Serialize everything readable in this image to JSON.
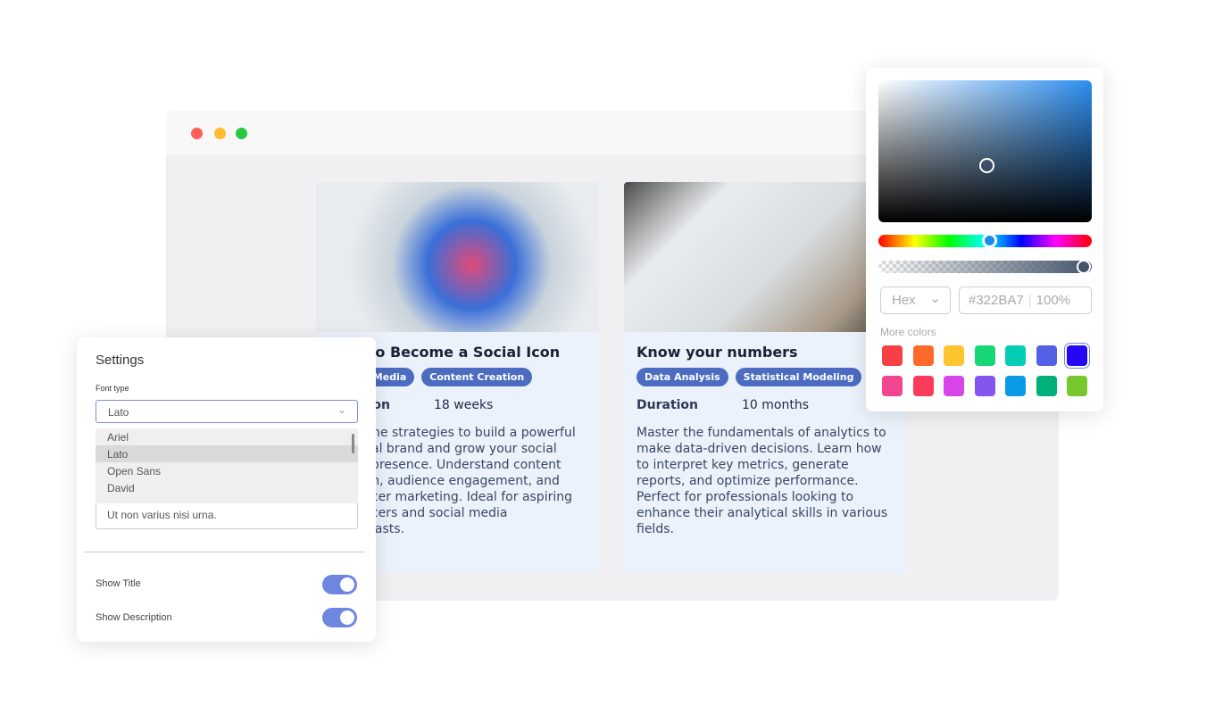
{
  "window": {
    "controls": [
      "#fe5f57",
      "#febc2e",
      "#28c840"
    ]
  },
  "cards": [
    {
      "title": "How to Become a Social Icon",
      "tags": [
        "Social Media",
        "Content Creation"
      ],
      "duration_label": "Duration",
      "duration": "18 weeks",
      "description": "Learn the strategies to build a powerful personal brand and grow your social media presence. Understand content creation, audience engagement, and influencer marketing. Ideal for aspiring influencers and social media enthusiasts."
    },
    {
      "title": "Know your numbers",
      "tags": [
        "Data Analysis",
        "Statistical Modeling"
      ],
      "duration_label": "Duration",
      "duration": "10 months",
      "description": "Master the fundamentals of analytics to make data-driven decisions. Learn how to interpret key metrics, generate reports, and optimize performance. Perfect for professionals looking to enhance their analytical skills in various fields."
    }
  ],
  "settings": {
    "title": "Settings",
    "font_label": "Font type",
    "font_value": "Lato",
    "options": [
      "Ariel",
      "Lato",
      "Open Sans",
      "David"
    ],
    "textarea": "Ut non varius nisi urna.",
    "show_title": "Show Title",
    "show_description": "Show Description",
    "show_title_on": true,
    "show_description_on": true
  },
  "picker": {
    "format": "Hex",
    "hex": "#322BA7",
    "opacity": "100%",
    "more_colors": "More colors",
    "swatches": [
      "#f83f45",
      "#fe6a2c",
      "#ffc531",
      "#16d677",
      "#05cdb5",
      "#5460e6",
      "#2407f5",
      "#f2458f",
      "#fd3a59",
      "#d845e8",
      "#8256ef",
      "#0b9be5",
      "#00b07a",
      "#76c82e"
    ],
    "selected": "#2407f5"
  }
}
